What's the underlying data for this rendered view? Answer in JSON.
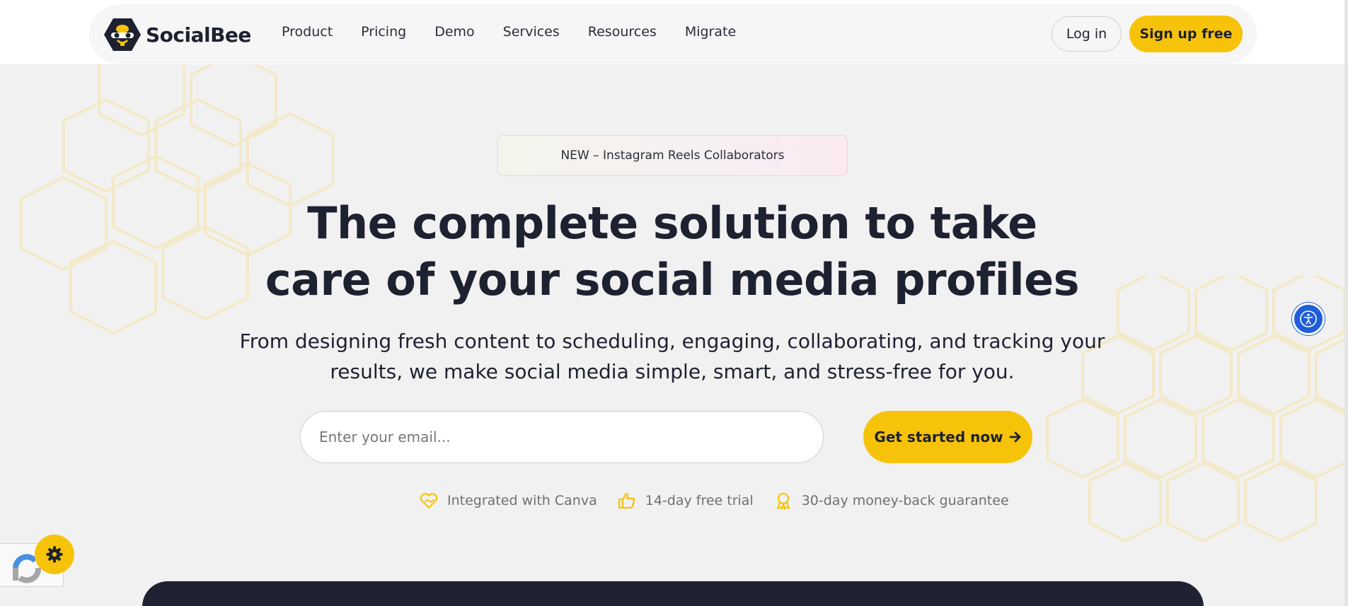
{
  "brand": {
    "name": "SocialBee",
    "accent": "#f6c30a",
    "dark": "#1e2130"
  },
  "nav": {
    "links": [
      "Product",
      "Pricing",
      "Demo",
      "Services",
      "Resources",
      "Migrate"
    ],
    "login_label": "Log in",
    "signup_label": "Sign up free"
  },
  "hero": {
    "badge": "NEW – Instagram Reels Collaborators",
    "headline_line1": "The complete solution to take",
    "headline_line2": "care of your social media profiles",
    "subhead_line1": "From designing fresh content to scheduling, engaging, collaborating, and tracking your",
    "subhead_line2": "results, we make social media simple, smart, and stress-free for you.",
    "email_placeholder": "Enter your email...",
    "cta_label": "Get started now",
    "features": [
      {
        "icon": "canva-heart-icon",
        "text": "Integrated with Canva"
      },
      {
        "icon": "thumbs-up-icon",
        "text": "14-day free trial"
      },
      {
        "icon": "award-ribbon-icon",
        "text": "30-day money-back guarantee"
      }
    ]
  },
  "widgets": {
    "accessibility_icon": "accessibility-icon",
    "settings_icon": "gear-icon",
    "recaptcha_icon": "recaptcha-icon"
  }
}
